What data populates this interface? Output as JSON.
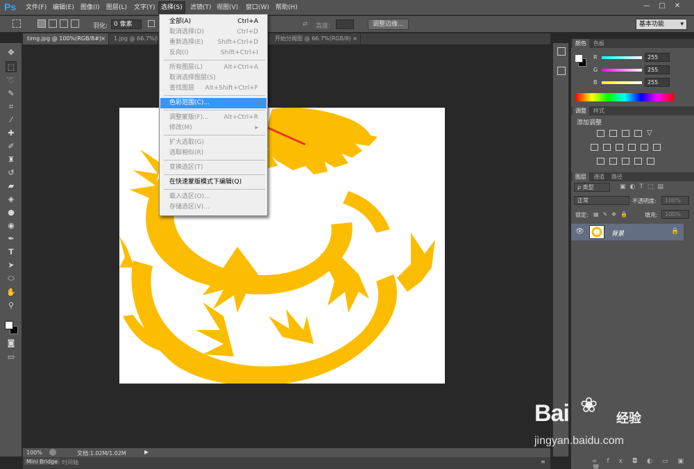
{
  "app": {
    "logo": "Ps",
    "menus": [
      "文件(F)",
      "编辑(E)",
      "图像(I)",
      "图层(L)",
      "文字(Y)",
      "选择(S)",
      "滤镜(T)",
      "视图(V)",
      "窗口(W)",
      "帮助(H)"
    ],
    "window_controls": [
      "—",
      "□",
      "✕"
    ]
  },
  "options": {
    "feather_label": "羽化:",
    "feather_value": "0 像素",
    "height_label": "高度:",
    "refine_edge_button": "调整边缘...",
    "workspace": "基本功能"
  },
  "tabs": [
    {
      "label": "timg.jpg @ 100%(RGB/8#)",
      "close": "×"
    },
    {
      "label": "1.jpg @ 66.7%(R",
      "close": ""
    },
    {
      "label": "开始分阁图 @ 66.7%(RGB/8)",
      "close": "×"
    }
  ],
  "select_menu": {
    "items": [
      {
        "label": "全部(A)",
        "shortcut": "Ctrl+A",
        "state": "bold"
      },
      {
        "label": "取消选择(D)",
        "shortcut": "Ctrl+D",
        "state": "dis"
      },
      {
        "label": "重新选择(E)",
        "shortcut": "Shift+Ctrl+D",
        "state": "dis"
      },
      {
        "label": "反向(I)",
        "shortcut": "Shift+Ctrl+I",
        "state": "dis"
      },
      {
        "label": "所有图层(L)",
        "shortcut": "Alt+Ctrl+A",
        "state": "dis"
      },
      {
        "label": "取消选择图层(S)",
        "shortcut": "",
        "state": "dis"
      },
      {
        "label": "查找图层",
        "shortcut": "Alt+Shift+Ctrl+F",
        "state": "dis"
      },
      {
        "label": "色彩范围(C)...",
        "shortcut": "",
        "state": "hl"
      },
      {
        "label": "调整蒙版(F)...",
        "shortcut": "Alt+Ctrl+R",
        "state": "dis"
      },
      {
        "label": "修改(M)",
        "shortcut": "▸",
        "state": "dis"
      },
      {
        "label": "扩大选取(G)",
        "shortcut": "",
        "state": "dis"
      },
      {
        "label": "选取相似(R)",
        "shortcut": "",
        "state": "dis"
      },
      {
        "label": "变换选区(T)",
        "shortcut": "",
        "state": "dis"
      },
      {
        "label": "在快速蒙版模式下编辑(Q)",
        "shortcut": "",
        "state": "bold"
      },
      {
        "label": "载入选区(O)...",
        "shortcut": "",
        "state": "dis"
      },
      {
        "label": "存储选区(V)...",
        "shortcut": "",
        "state": "dis"
      }
    ]
  },
  "status": {
    "zoom": "100%",
    "doc_info": "文档:1.02M/1.02M",
    "bottom_tabs": [
      "Mini Bridge",
      "时间轴"
    ]
  },
  "color_panel": {
    "tabs": [
      "颜色",
      "色板"
    ],
    "channels": [
      {
        "name": "R",
        "value": "255"
      },
      {
        "name": "G",
        "value": "255"
      },
      {
        "name": "B",
        "value": "255"
      }
    ]
  },
  "adjust_panel": {
    "tabs": [
      "调整",
      "样式"
    ],
    "title": "添加调整"
  },
  "layers_panel": {
    "tabs": [
      "图层",
      "通道",
      "路径"
    ],
    "filter": "ρ 类型",
    "blend_mode": "正常",
    "opacity_label": "不透明度:",
    "opacity_value": "100%",
    "lock_label": "锁定:",
    "fill_label": "填充:",
    "fill_value": "100%",
    "layer_name": "背景"
  },
  "watermark": {
    "brand": "Bai",
    "brand_cn": "经验",
    "url": "jingyan.baidu.com"
  },
  "colors": {
    "dragon": "#fcbd00",
    "highlight": "#3797f0",
    "arrow": "#e8392b"
  }
}
